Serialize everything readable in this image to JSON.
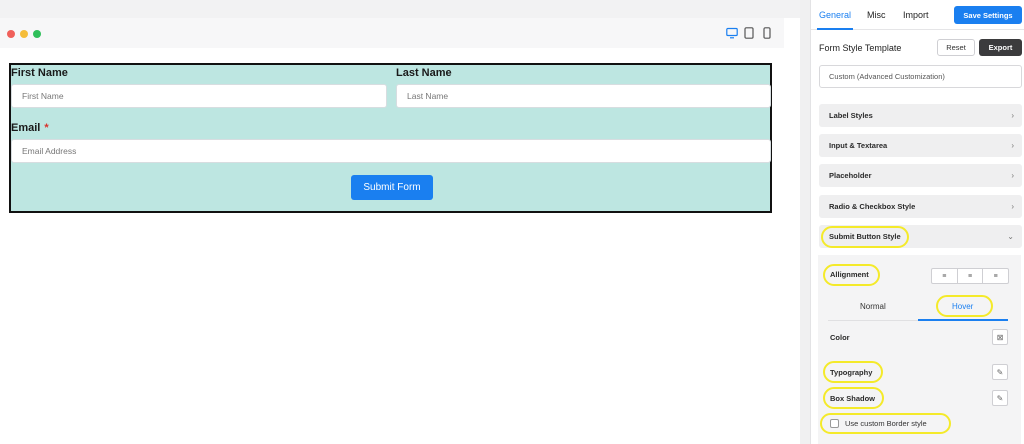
{
  "preview": {
    "form": {
      "first_name_label": "First Name",
      "first_name_placeholder": "First Name",
      "last_name_label": "Last Name",
      "last_name_placeholder": "Last Name",
      "email_label": "Email",
      "email_required_mark": "*",
      "email_placeholder": "Email Address",
      "submit_label": "Submit Form"
    },
    "device_icons": [
      "desktop-icon",
      "tablet-icon",
      "mobile-icon"
    ],
    "colors": {
      "form_bg": "#bde6e1",
      "accent": "#1a7ff0"
    }
  },
  "sidebar": {
    "tabs": [
      {
        "label": "General"
      },
      {
        "label": "Misc"
      },
      {
        "label": "Import"
      }
    ],
    "save_label": "Save Settings",
    "template_title": "Form Style Template",
    "reset_label": "Reset",
    "export_label": "Export",
    "template_value": "Custom (Advanced Customization)",
    "accordions": [
      {
        "label": "Label Styles"
      },
      {
        "label": "Input & Textarea"
      },
      {
        "label": "Placeholder"
      },
      {
        "label": "Radio & Checkbox Style"
      },
      {
        "label": "Submit Button Style"
      }
    ],
    "submit_panel": {
      "alignment_label": "Allignment",
      "state_tabs": [
        {
          "label": "Normal"
        },
        {
          "label": "Hover"
        }
      ],
      "color_label": "Color",
      "typography_label": "Typography",
      "box_shadow_label": "Box Shadow",
      "border_checkbox_label": "Use custom Border style"
    }
  }
}
